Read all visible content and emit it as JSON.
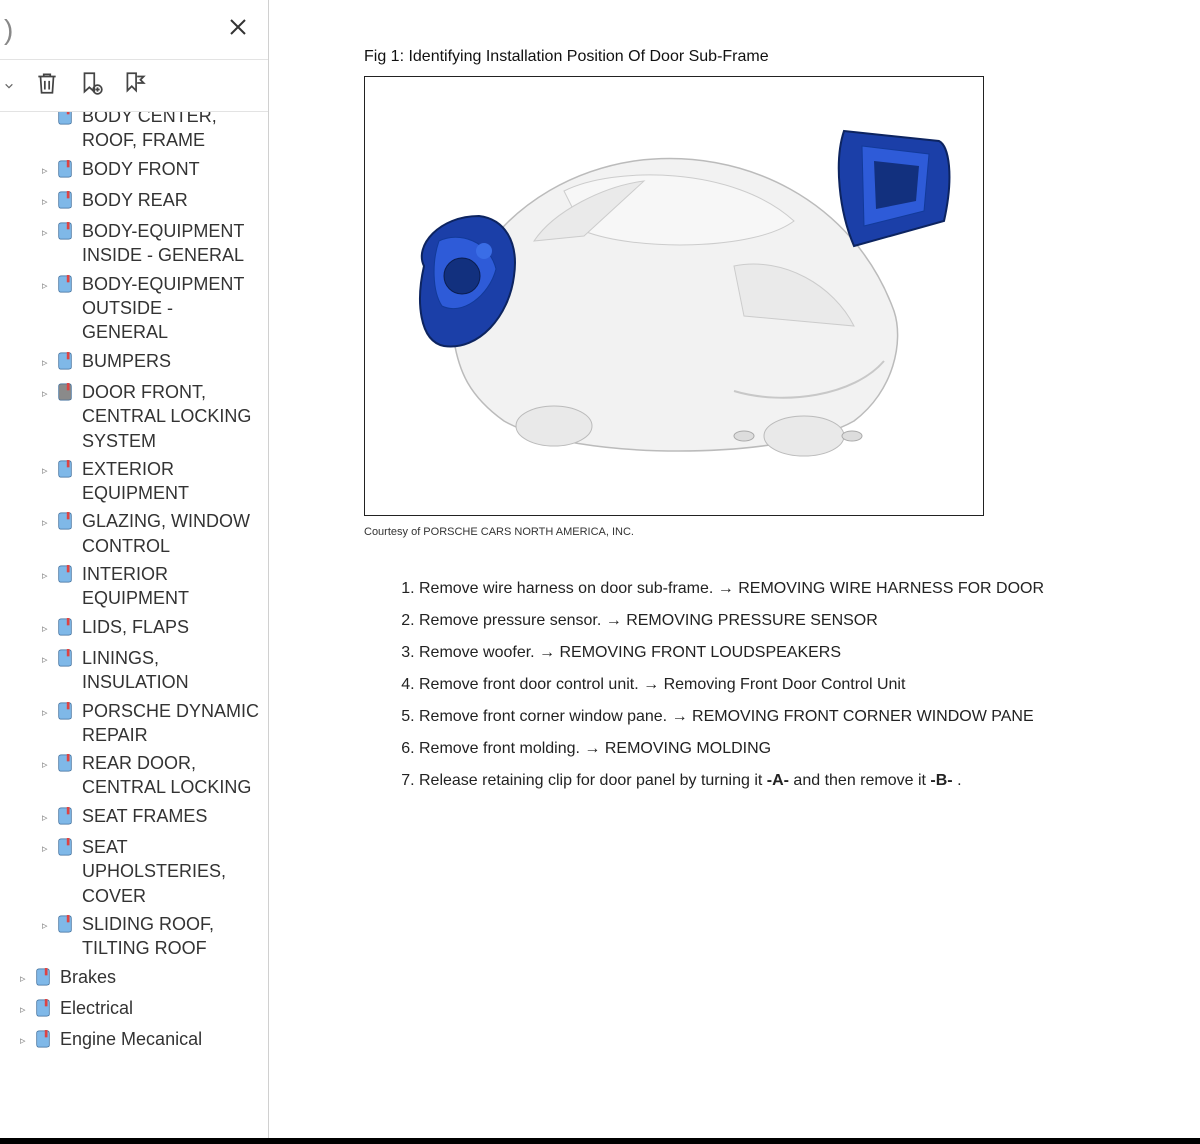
{
  "sidebar": {
    "top_placeholder": ")",
    "tools": {
      "delete_title": "Delete bookmark",
      "add_title": "Add bookmark",
      "ribbon_title": "Bookmark ribbon"
    },
    "tree": [
      {
        "indent": 2,
        "label": "BODY CENTER, ROOF, FRAME",
        "twist": "",
        "cutoff": true
      },
      {
        "indent": 2,
        "label": "BODY FRONT",
        "twist": "▹"
      },
      {
        "indent": 2,
        "label": "BODY REAR",
        "twist": "▹"
      },
      {
        "indent": 2,
        "label": "BODY-EQUIPMENT INSIDE - GENERAL",
        "twist": "▹"
      },
      {
        "indent": 2,
        "label": "BODY-EQUIPMENT OUTSIDE - GENERAL",
        "twist": "▹"
      },
      {
        "indent": 2,
        "label": "BUMPERS",
        "twist": "▹"
      },
      {
        "indent": 2,
        "label": "DOOR FRONT, CENTRAL LOCKING SYSTEM",
        "twist": "▹",
        "selected": true
      },
      {
        "indent": 2,
        "label": "EXTERIOR EQUIPMENT",
        "twist": "▹"
      },
      {
        "indent": 2,
        "label": "GLAZING, WINDOW CONTROL",
        "twist": "▹"
      },
      {
        "indent": 2,
        "label": "INTERIOR EQUIPMENT",
        "twist": "▹"
      },
      {
        "indent": 2,
        "label": "LIDS, FLAPS",
        "twist": "▹"
      },
      {
        "indent": 2,
        "label": "LININGS, INSULATION",
        "twist": "▹"
      },
      {
        "indent": 2,
        "label": "PORSCHE DYNAMIC REPAIR",
        "twist": "▹"
      },
      {
        "indent": 2,
        "label": "REAR DOOR, CENTRAL LOCKING",
        "twist": "▹"
      },
      {
        "indent": 2,
        "label": "SEAT FRAMES",
        "twist": "▹"
      },
      {
        "indent": 2,
        "label": "SEAT UPHOLSTERIES, COVER",
        "twist": "▹"
      },
      {
        "indent": 2,
        "label": "SLIDING ROOF, TILTING ROOF",
        "twist": "▹"
      },
      {
        "indent": 1,
        "label": "Brakes",
        "twist": "▹"
      },
      {
        "indent": 1,
        "label": "Electrical",
        "twist": "▹"
      },
      {
        "indent": 1,
        "label": "Engine Mecanical",
        "twist": "▹"
      }
    ]
  },
  "document": {
    "figure_caption": "Fig 1: Identifying Installation Position Of Door Sub-Frame",
    "courtesy": "Courtesy of PORSCHE CARS NORTH AMERICA, INC.",
    "steps": [
      {
        "n": "1",
        "text": "Remove wire harness on door sub-frame. → ",
        "link": "REMOVING WIRE HARNESS FOR DOOR"
      },
      {
        "n": "2",
        "text": "Remove pressure sensor. → ",
        "link": "REMOVING PRESSURE SENSOR"
      },
      {
        "n": "3",
        "text": "Remove woofer. → ",
        "link": "REMOVING FRONT LOUDSPEAKERS"
      },
      {
        "n": "4",
        "text": "Remove front door control unit. → ",
        "link": "Removing Front Door Control Unit"
      },
      {
        "n": "5",
        "text": "Remove front corner window pane. → ",
        "link": "REMOVING FRONT CORNER WINDOW PANE"
      },
      {
        "n": "6",
        "text": "Remove front molding. → ",
        "link": "REMOVING MOLDING"
      },
      {
        "n": "7",
        "text": "Release retaining clip for door panel by turning it ",
        "bold1": "-A-",
        "mid": "  and then remove it ",
        "bold2": "-B-",
        "tail": "   ."
      }
    ]
  }
}
